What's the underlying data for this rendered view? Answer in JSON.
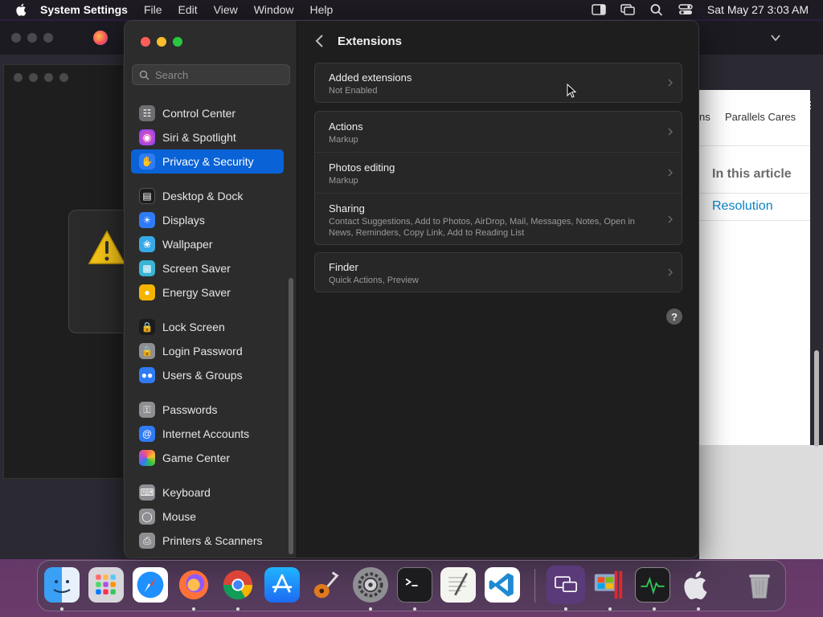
{
  "menubar": {
    "app_name": "System Settings",
    "menus": [
      "File",
      "Edit",
      "View",
      "Window",
      "Help"
    ],
    "clock": "Sat May 27  3:03 AM"
  },
  "background_browser": {
    "nav_partial": "ns",
    "nav_item": "Parallels Cares",
    "article_heading": "In this article",
    "article_link": "Resolution"
  },
  "settings": {
    "search_placeholder": "Search",
    "sidebar": {
      "groups": [
        [
          {
            "label": "Control Center",
            "icon": "control-center-icon",
            "color": "#6e6e73"
          },
          {
            "label": "Siri & Spotlight",
            "icon": "siri-icon",
            "color": "#b24bd8"
          },
          {
            "label": "Privacy & Security",
            "icon": "hand-icon",
            "color": "#2f7bf5",
            "selected": true
          }
        ],
        [
          {
            "label": "Desktop & Dock",
            "icon": "dock-icon",
            "color": "#1c1c1e"
          },
          {
            "label": "Displays",
            "icon": "sun-icon",
            "color": "#2f7bf5"
          },
          {
            "label": "Wallpaper",
            "icon": "flower-icon",
            "color": "#37a9e8"
          },
          {
            "label": "Screen Saver",
            "icon": "screen-saver-icon",
            "color": "#39b3d6"
          },
          {
            "label": "Energy Saver",
            "icon": "bulb-icon",
            "color": "#f5b400"
          }
        ],
        [
          {
            "label": "Lock Screen",
            "icon": "lock-icon",
            "color": "#1c1c1e"
          },
          {
            "label": "Login Password",
            "icon": "lock-icon",
            "color": "#8e8e93"
          },
          {
            "label": "Users & Groups",
            "icon": "users-icon",
            "color": "#2f7bf5"
          }
        ],
        [
          {
            "label": "Passwords",
            "icon": "key-icon",
            "color": "#8e8e93"
          },
          {
            "label": "Internet Accounts",
            "icon": "at-icon",
            "color": "#2f7bf5"
          },
          {
            "label": "Game Center",
            "icon": "game-center-icon",
            "color": "#e8e8e8"
          }
        ],
        [
          {
            "label": "Keyboard",
            "icon": "keyboard-icon",
            "color": "#8e8e93"
          },
          {
            "label": "Mouse",
            "icon": "mouse-icon",
            "color": "#8e8e93"
          },
          {
            "label": "Printers & Scanners",
            "icon": "printer-icon",
            "color": "#8e8e93"
          }
        ]
      ]
    },
    "main": {
      "title": "Extensions",
      "added": {
        "label": "Added extensions",
        "sub": "Not Enabled"
      },
      "group2": [
        {
          "label": "Actions",
          "sub": "Markup"
        },
        {
          "label": "Photos editing",
          "sub": "Markup"
        },
        {
          "label": "Sharing",
          "sub": "Contact Suggestions, Add to Photos, AirDrop, Mail, Messages, Notes, Open in News, Reminders, Copy Link, Add to Reading List"
        }
      ],
      "finder": {
        "label": "Finder",
        "sub": "Quick Actions, Preview"
      },
      "help_label": "?"
    }
  },
  "dock": {
    "apps": [
      {
        "name": "finder",
        "running": true
      },
      {
        "name": "launchpad",
        "running": false
      },
      {
        "name": "safari",
        "running": false
      },
      {
        "name": "firefox",
        "running": true
      },
      {
        "name": "chrome",
        "running": true
      },
      {
        "name": "app-store",
        "running": false
      },
      {
        "name": "garageband",
        "running": false
      },
      {
        "name": "system-settings",
        "running": true
      },
      {
        "name": "terminal",
        "running": true
      },
      {
        "name": "textedit",
        "running": false
      },
      {
        "name": "vscode",
        "running": false
      },
      {
        "name": "parallels-desktop",
        "running": true
      },
      {
        "name": "parallels-windows",
        "running": true
      },
      {
        "name": "activity-monitor",
        "running": true
      },
      {
        "name": "macos-vm",
        "running": true
      },
      {
        "name": "trash",
        "running": false
      }
    ]
  }
}
